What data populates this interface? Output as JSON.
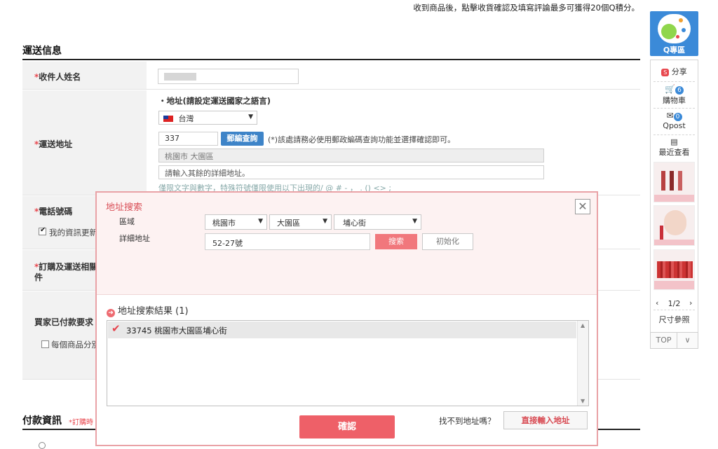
{
  "top_notice": "收到商品後，點擊收貨確認及填寫評論最多可獲得20個Q積分。",
  "shipping": {
    "section_title": "運送信息",
    "recipient_label": "收件人姓名",
    "address_label": "運送地址",
    "address_subtitle": "・地址(請設定運送國家之語言)",
    "country": "台灣",
    "zip_value": "337",
    "zip_lookup_button": "郵編查詢",
    "zip_note": "(*)該處請務必使用郵政編碼查詢功能並選擇確認即可。",
    "city_district": "桃園市 大園區",
    "detail_placeholder": "請輸入其餘的詳細地址。",
    "char_hint": "僅限文字與數字，特殊符號僅限使用以下出現的/ @ # - ， . () <> ;",
    "phone_label": "電話號碼",
    "phone_checkbox_label": "我的資訊更新",
    "order_label_line1": "訂購及運送相關",
    "order_label_line2": "件",
    "paid_request_label": "買家已付款要求",
    "each_item_label": "每個商品分別"
  },
  "payment": {
    "section_title": "付款資訊",
    "subtitle": "*訂購時"
  },
  "modal": {
    "title": "地址搜索",
    "region_label": "區域",
    "detail_label": "詳細地址",
    "city": "桃園市",
    "district": "大園區",
    "street": "埔心街",
    "detail_value": "52-27號",
    "search_button": "搜索",
    "reset_button": "初始化",
    "results_title": "地址搜索結果 (1)",
    "results": [
      {
        "text": "33745 桃園市大園區埔心街"
      }
    ],
    "confirm_button": "確認",
    "cant_find_text": "找不到地址嗎？",
    "direct_input_button": "直接輸入地址"
  },
  "sidebar": {
    "qzone_label": "Q專區",
    "share_label": "分享",
    "cart_label": "購物車",
    "cart_count": "6",
    "qpost_label": "Qpost",
    "qpost_count": "0",
    "recent_label": "最近查看",
    "page_indicator": "1/2",
    "size_label": "尺寸參照",
    "top_label": "TOP"
  },
  "colors": {
    "accent_red": "#e8484f",
    "modal_border": "#e9a2a6",
    "blue": "#3b8ad8"
  }
}
